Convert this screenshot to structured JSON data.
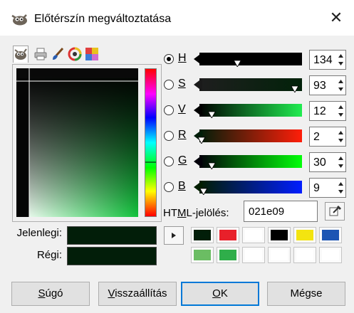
{
  "window": {
    "title": "Előtérszín megváltoztatása",
    "close_glyph": "✕"
  },
  "notebook_tabs": [
    {
      "icon": "gimp-wilber-icon",
      "active": true
    },
    {
      "icon": "cmyk-printer-icon",
      "active": false
    },
    {
      "icon": "watercolor-brush-icon",
      "active": false
    },
    {
      "icon": "color-wheel-icon",
      "active": false
    },
    {
      "icon": "palette-scales-icon",
      "active": false
    }
  ],
  "channels": [
    {
      "key": "H",
      "label": "H",
      "value": "134",
      "checked": true
    },
    {
      "key": "S",
      "label": "S",
      "value": "93",
      "checked": false
    },
    {
      "key": "V",
      "label": "V",
      "value": "12",
      "checked": false
    },
    {
      "key": "R",
      "label": "R",
      "value": "2",
      "checked": false
    },
    {
      "key": "G",
      "label": "G",
      "value": "30",
      "checked": false
    },
    {
      "key": "B",
      "label": "B",
      "value": "9",
      "checked": false
    }
  ],
  "channel_levels": {
    "H": 0.37,
    "S": 0.93,
    "V": 0.12,
    "R": 0.02,
    "G": 0.12,
    "B": 0.04
  },
  "hex": {
    "label": "HTML-jelölés:",
    "value": "021e09"
  },
  "swatches": {
    "current_label": "Jelenlegi:",
    "old_label": "Régi:",
    "current_color": "#021e09",
    "old_color": "#021e09"
  },
  "history": {
    "row1": [
      "#021e09",
      "#e8202a",
      "#ffffff",
      "#000000",
      "#f3e410",
      "#1c55b3"
    ],
    "row2": [
      "#6bbd63",
      "#2fae4a",
      "#ffffff",
      "#ffffff",
      "#ffffff",
      "#ffffff"
    ]
  },
  "buttons": {
    "help": "Súgó",
    "reset": "Visszaállítás",
    "ok": "OK",
    "cancel": "Mégse"
  },
  "colors": {
    "accent": "#0078d7",
    "picked": "#021e09"
  }
}
